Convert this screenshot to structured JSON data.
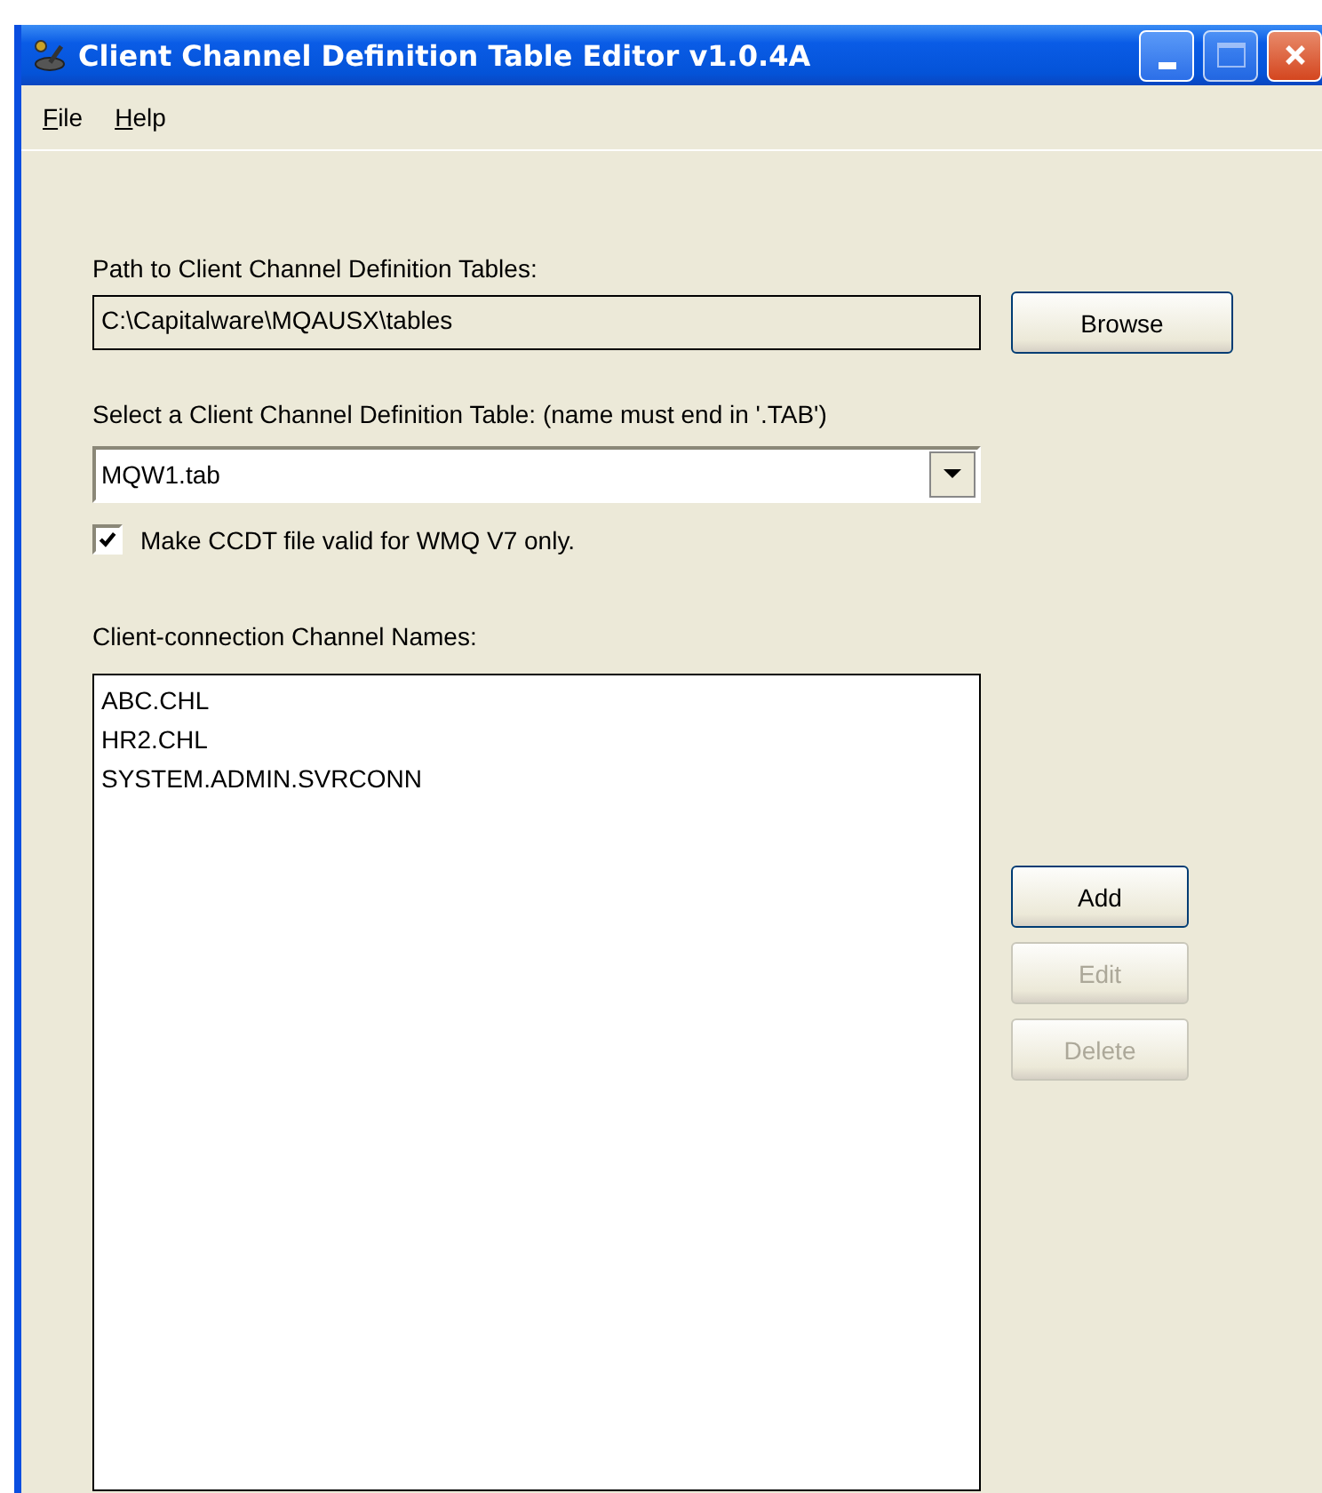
{
  "window": {
    "title": "Client Channel Definition Table Editor v1.0.4A"
  },
  "menu": [
    {
      "label": "File"
    },
    {
      "label": "Help"
    }
  ],
  "path": {
    "label": "Path to Client Channel Definition Tables:",
    "value": "C:\\Capitalware\\MQAUSX\\tables",
    "button": "Browse"
  },
  "table_select": {
    "label": "Select a Client Channel Definition Table: (name must end in '.TAB')",
    "value": "MQW1.tab"
  },
  "v7_option": {
    "label": "Make CCDT file valid for WMQ V7 only.",
    "checked": true
  },
  "channels": {
    "label": "Client-connection Channel Names:",
    "items": [
      {
        "name": "ABC.CHL",
        "selected": false
      },
      {
        "name": "HR2.CHL",
        "selected": false
      },
      {
        "name": "SYSTEM.ADMIN.SVRCONN",
        "selected": false
      }
    ]
  },
  "buttons": [
    {
      "label": "Add",
      "disabled": false
    },
    {
      "label": "Edit",
      "disabled": true
    },
    {
      "label": "Delete",
      "disabled": true
    }
  ]
}
